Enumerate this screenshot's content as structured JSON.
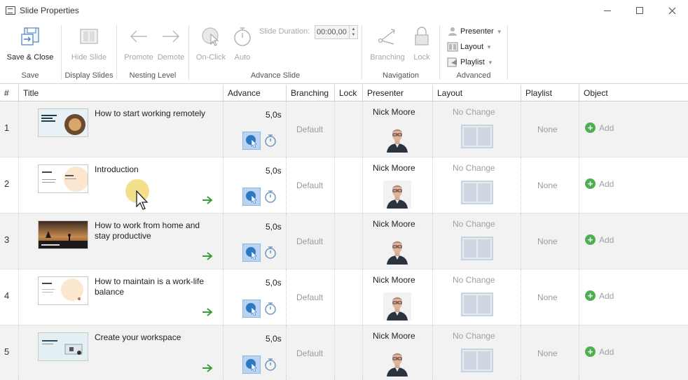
{
  "window": {
    "title": "Slide Properties"
  },
  "ribbon": {
    "save_close": "Save & Close",
    "save_group": "Save",
    "hide_slide": "Hide Slide",
    "display_group": "Display Slides",
    "promote": "Promote",
    "demote": "Demote",
    "nesting_group": "Nesting Level",
    "on_click": "On-Click",
    "auto": "Auto",
    "slide_duration_label": "Slide Duration:",
    "slide_duration_value": "00:00,00",
    "advance_group": "Advance Slide",
    "branching": "Branching",
    "lock": "Lock",
    "navigation_group": "Navigation",
    "presenter": "Presenter",
    "layout": "Layout",
    "playlist": "Playlist",
    "advanced_group": "Advanced"
  },
  "columns": [
    "#",
    "Title",
    "Advance",
    "Branching",
    "Lock",
    "Presenter",
    "Layout",
    "Playlist",
    "Object"
  ],
  "rows": [
    {
      "num": "1",
      "title": "How to start working remotely",
      "advance": "5,0s",
      "branching": "Default",
      "presenter": "Nick Moore",
      "layout": "No Change",
      "playlist": "None",
      "object": "Add",
      "thumb": "remote",
      "arrow": false
    },
    {
      "num": "2",
      "title": "Introduction",
      "advance": "5,0s",
      "branching": "Default",
      "presenter": "Nick Moore",
      "layout": "No Change",
      "playlist": "None",
      "object": "Add",
      "thumb": "intro",
      "arrow": true
    },
    {
      "num": "3",
      "title": "How to work from home and stay productive",
      "advance": "5,0s",
      "branching": "Default",
      "presenter": "Nick Moore",
      "layout": "No Change",
      "playlist": "None",
      "object": "Add",
      "thumb": "sunset",
      "arrow": true
    },
    {
      "num": "4",
      "title": "How to maintain is a work-life balance",
      "advance": "5,0s",
      "branching": "Default",
      "presenter": "Nick Moore",
      "layout": "No Change",
      "playlist": "None",
      "object": "Add",
      "thumb": "balance",
      "arrow": true
    },
    {
      "num": "5",
      "title": "Create your workspace",
      "advance": "5,0s",
      "branching": "Default",
      "presenter": "Nick Moore",
      "layout": "No Change",
      "playlist": "None",
      "object": "Add",
      "thumb": "workspace",
      "arrow": true
    }
  ]
}
